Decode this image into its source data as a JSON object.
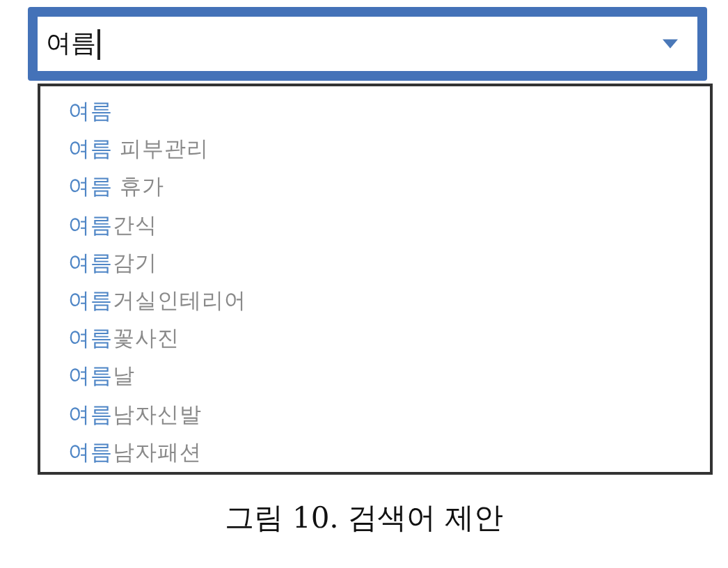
{
  "search": {
    "value": "여름"
  },
  "suggestions": [
    {
      "match": "여름"
    },
    {
      "match": "여름",
      "rest": " 피부관리"
    },
    {
      "match": "여름",
      "rest": " 휴가"
    },
    {
      "match": "여름",
      "rest": "간식"
    },
    {
      "match": "여름",
      "rest": "감기"
    },
    {
      "match": "여름",
      "rest": "거실인테리어"
    },
    {
      "match": "여름",
      "rest": "꽃사진"
    },
    {
      "match": "여름",
      "rest": "날"
    },
    {
      "match": "여름",
      "rest": "남자신발"
    },
    {
      "match": "여름",
      "rest": "남자패션"
    }
  ],
  "caption": "그림 10. 검색어 제안"
}
